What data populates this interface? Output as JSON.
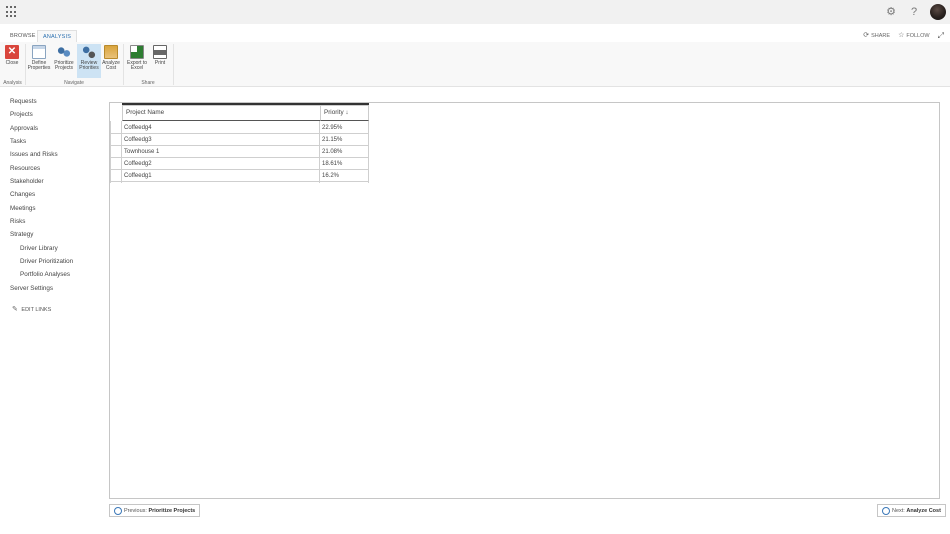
{
  "suitebar": {
    "settings_icon": "gear-icon",
    "help_label": "?",
    "avatar_icon": "user-avatar"
  },
  "tabs": [
    {
      "label": "BROWSE"
    },
    {
      "label": "ANALYSIS"
    }
  ],
  "top_actions": {
    "share_label": "SHARE",
    "follow_label": "FOLLOW"
  },
  "ribbon": {
    "buttons": [
      {
        "label1": "Close",
        "label2": "",
        "icon": "close-icon",
        "color": "#d9453c"
      },
      {
        "label1": "Define",
        "label2": "Properties",
        "icon": "define-properties-icon",
        "color": "#6a8fb5"
      },
      {
        "label1": "Prioritize",
        "label2": "Projects",
        "icon": "prioritize-projects-icon",
        "color": "#3e6fa3"
      },
      {
        "label1": "Review",
        "label2": "Priorities",
        "icon": "review-priorities-icon",
        "color": "#3e6fa3"
      },
      {
        "label1": "Analyze",
        "label2": "Cost",
        "icon": "analyze-cost-icon",
        "color": "#d9a43c"
      },
      {
        "label1": "Export to",
        "label2": "Excel",
        "icon": "export-excel-icon",
        "color": "#2e7d32"
      },
      {
        "label1": "Print",
        "label2": "",
        "icon": "print-icon",
        "color": "#555555"
      }
    ],
    "groups": [
      {
        "label": "Analysis"
      },
      {
        "label": "Navigate"
      },
      {
        "label": "Share"
      }
    ]
  },
  "nav": {
    "items": [
      {
        "label": "Requests"
      },
      {
        "label": "Projects"
      },
      {
        "label": "Approvals"
      },
      {
        "label": "Tasks"
      },
      {
        "label": "Issues and Risks"
      },
      {
        "label": "Resources"
      },
      {
        "label": "Stakeholder"
      },
      {
        "label": "Changes"
      },
      {
        "label": "Meetings"
      },
      {
        "label": "Risks"
      },
      {
        "label": "Strategy"
      },
      {
        "label": "Driver Library"
      },
      {
        "label": "Driver Prioritization"
      },
      {
        "label": "Portfolio Analyses"
      },
      {
        "label": "Server Settings"
      }
    ],
    "edit_links": "EDIT LINKS"
  },
  "grid": {
    "headers": {
      "name": "Project Name",
      "priority": "Priority ↓"
    },
    "rows": [
      {
        "name": "Coffeedg4",
        "priority": "22.95%"
      },
      {
        "name": "Coffeedg3",
        "priority": "21.15%"
      },
      {
        "name": "Townhouse 1",
        "priority": "21.08%"
      },
      {
        "name": "Coffeedg2",
        "priority": "18.61%"
      },
      {
        "name": "Coffeedg1",
        "priority": "16.2%"
      }
    ]
  },
  "footer": {
    "prev_prefix": "Previous:",
    "prev_label": "Prioritize Projects",
    "next_prefix": "Next:",
    "next_label": "Analyze Cost"
  },
  "colors": {
    "accent": "#2a6fb0",
    "selected": "#cde3f4"
  }
}
